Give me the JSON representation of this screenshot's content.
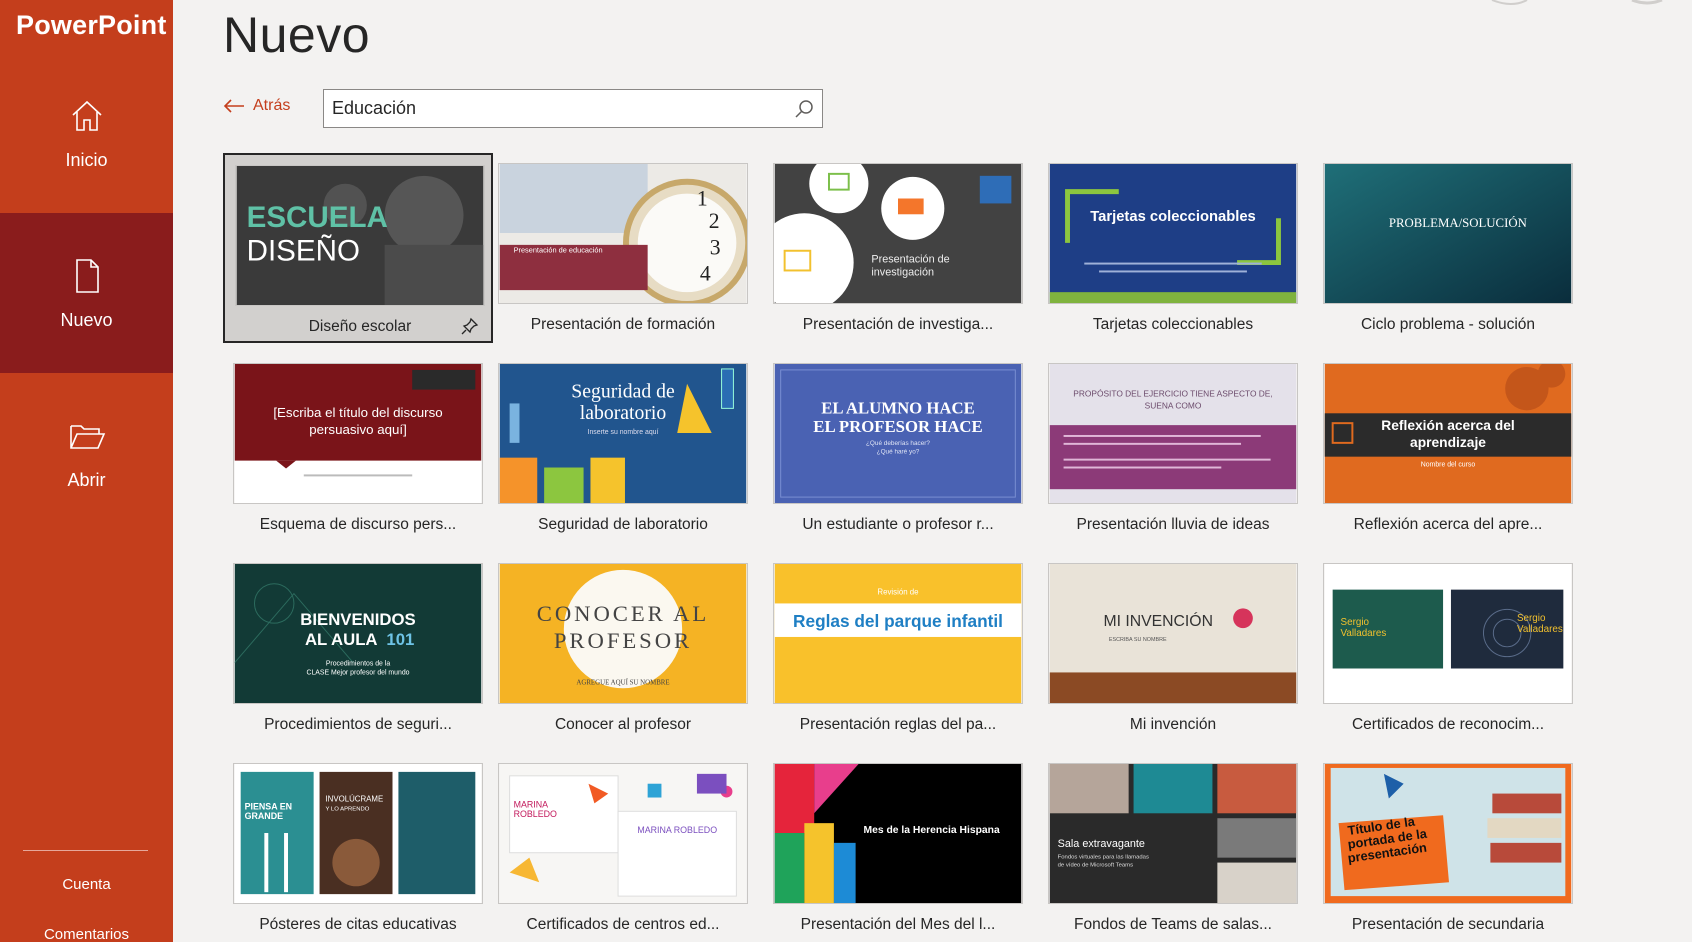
{
  "app": {
    "name": "PowerPoint"
  },
  "sidebar": {
    "items": [
      {
        "label": "Inicio",
        "icon": "home-icon"
      },
      {
        "label": "Nuevo",
        "icon": "new-document-icon",
        "active": true
      },
      {
        "label": "Abrir",
        "icon": "folder-open-icon"
      }
    ],
    "footer": [
      {
        "label": "Cuenta"
      },
      {
        "label": "Comentarios"
      }
    ]
  },
  "header": {
    "title": "Nuevo",
    "back_label": "Atrás",
    "search": {
      "value": "Educación",
      "placeholder": ""
    }
  },
  "templates": [
    {
      "label": "Diseño escolar",
      "thumb_text": [
        "ESCUELA",
        "DISEÑO"
      ],
      "selected": true
    },
    {
      "label": "Presentación de formación",
      "thumb_text": [
        "Presentación de educación"
      ]
    },
    {
      "label": "Presentación de investiga...",
      "thumb_text": [
        "Presentación de",
        "investigación"
      ]
    },
    {
      "label": "Tarjetas coleccionables",
      "thumb_text": [
        "Tarjetas coleccionables"
      ]
    },
    {
      "label": "Ciclo problema - solución",
      "thumb_text": [
        "PROBLEMA/SOLUCIÓN"
      ]
    },
    {
      "label": "Esquema de discurso pers...",
      "thumb_text": [
        "[Escriba el título del discurso",
        "persuasivo aquí]"
      ]
    },
    {
      "label": "Seguridad de laboratorio",
      "thumb_text": [
        "Seguridad de",
        "laboratorio",
        "Inserte su nombre aquí"
      ]
    },
    {
      "label": "Un estudiante o profesor r...",
      "thumb_text": [
        "EL ALUMNO HACE",
        "EL PROFESOR HACE",
        "¿Qué deberías hacer?",
        "¿Qué haré yo?"
      ]
    },
    {
      "label": "Presentación lluvia de ideas",
      "thumb_text": [
        "PROPÓSITO DEL EJERCICIO TIENE ASPECTO DE,",
        "SUENA COMO"
      ]
    },
    {
      "label": "Reflexión acerca del apre...",
      "thumb_text": [
        "Reflexión acerca del",
        "aprendizaje",
        "Nombre del curso"
      ]
    },
    {
      "label": "Procedimientos de seguri...",
      "thumb_text": [
        "BIENVENIDOS",
        "AL AULA",
        "101",
        "Procedimientos de la",
        "CLASE Mejor profesor del mundo"
      ]
    },
    {
      "label": "Conocer al profesor",
      "thumb_text": [
        "CONOCER AL",
        "PROFESOR",
        "AGREGUE AQUÍ SU NOMBRE"
      ]
    },
    {
      "label": "Presentación reglas del pa...",
      "thumb_text": [
        "Revisión de",
        "Reglas del parque infantil"
      ]
    },
    {
      "label": "Mi invención",
      "thumb_text": [
        "MI INVENCIÓN",
        "ESCRIBA SU NOMBRE"
      ]
    },
    {
      "label": "Certificados de reconocim...",
      "thumb_text": [
        "Sergio",
        "Valladares",
        "Sergio",
        "Valladares"
      ]
    },
    {
      "label": "Pósteres de citas educativas",
      "thumb_text": [
        "PIENSA EN",
        "GRANDE",
        "INVOLÚCRAME",
        "Y LO APRENDO"
      ]
    },
    {
      "label": "Certificados de centros ed...",
      "thumb_text": [
        "MARINA",
        "ROBLEDO",
        "MARINA ROBLEDO"
      ]
    },
    {
      "label": "Presentación del Mes del l...",
      "thumb_text": [
        "Mes de la Herencia Hispana"
      ]
    },
    {
      "label": "Fondos de Teams de salas...",
      "thumb_text": [
        "Sala extravagante",
        "Fondos virtuales para las llamadas",
        "de vídeo de Microsoft Teams"
      ]
    },
    {
      "label": "Presentación de secundaria",
      "thumb_text": [
        "Título de la",
        "portada de la",
        "presentación"
      ]
    }
  ],
  "colors": {
    "sidebar": "#c43e1c",
    "sidebar_active": "#8a1c1c",
    "accent": "#c43e1c",
    "background": "#f3f2f1"
  }
}
